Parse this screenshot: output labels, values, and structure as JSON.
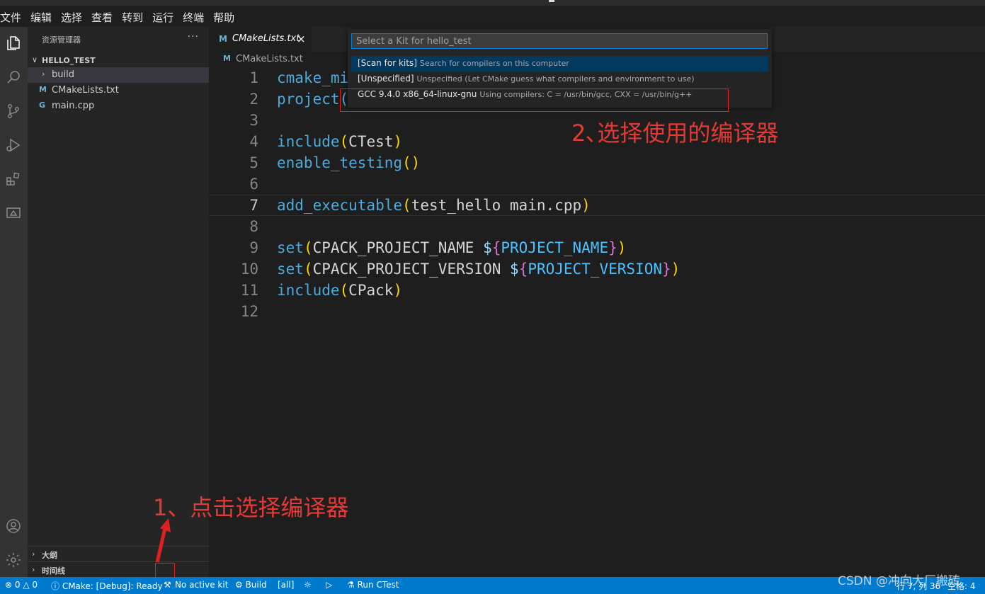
{
  "menu": [
    "文件",
    "编辑",
    "选择",
    "查看",
    "转到",
    "运行",
    "终端",
    "帮助"
  ],
  "explorer": {
    "title": "资源管理器",
    "more": "···",
    "folder": "HELLO_TEST",
    "items": [
      {
        "name": "build",
        "kind": "folder"
      },
      {
        "name": "CMakeLists.txt",
        "kind": "cmake",
        "icon": "M"
      },
      {
        "name": "main.cpp",
        "kind": "cpp",
        "icon": "G"
      }
    ],
    "outline": "大纲",
    "timeline": "时间线"
  },
  "tab": {
    "icon": "M",
    "name": "CMakeLists.txt",
    "close": "×"
  },
  "breadcrumb": {
    "icon": "M",
    "name": "CMakeLists.txt"
  },
  "editor": {
    "current_line": 7,
    "lines": [
      {
        "n": "1",
        "text": "cmake_mi"
      },
      {
        "n": "2",
        "text": "project("
      },
      {
        "n": "3",
        "text": ""
      },
      {
        "n": "4",
        "text": "include(CTest)"
      },
      {
        "n": "5",
        "text": "enable_testing()"
      },
      {
        "n": "6",
        "text": ""
      },
      {
        "n": "7",
        "text": "add_executable(test_hello main.cpp)"
      },
      {
        "n": "8",
        "text": ""
      },
      {
        "n": "9",
        "text": "set(CPACK_PROJECT_NAME ${PROJECT_NAME})"
      },
      {
        "n": "10",
        "text": "set(CPACK_PROJECT_VERSION ${PROJECT_VERSION})"
      },
      {
        "n": "11",
        "text": "include(CPack)"
      },
      {
        "n": "12",
        "text": ""
      }
    ]
  },
  "quick_pick": {
    "placeholder": "Select a Kit for hello_test",
    "items": [
      {
        "label": "[Scan for kits]",
        "description": "Search for compilers on this computer"
      },
      {
        "label": "[Unspecified]",
        "description": "Unspecified (Let CMake guess what compilers and environment to use)"
      },
      {
        "label": "GCC 9.4.0 x86_64-linux-gnu",
        "description": "Using compilers: C = /usr/bin/gcc, CXX = /usr/bin/g++"
      }
    ]
  },
  "annotations": {
    "step1": "1、点击选择编译器",
    "step2": "2､选择使用的编译器"
  },
  "status": {
    "errors": "⊗ 0 △ 0",
    "cmake": "ⓘ CMake: [Debug]: Ready",
    "kit": "No active kit",
    "build": "⚙ Build",
    "target": "[all]",
    "debug": "☼",
    "run": "▷",
    "ctest": "⚗ Run CTest",
    "position": "行 7, 列 36",
    "spaces": "空格: 4"
  },
  "watermark": "CSDN @冲向大厂搬砖",
  "colors": {
    "statusbar": "#007acc",
    "annotation": "#e53935",
    "accent": "#007fd4"
  }
}
